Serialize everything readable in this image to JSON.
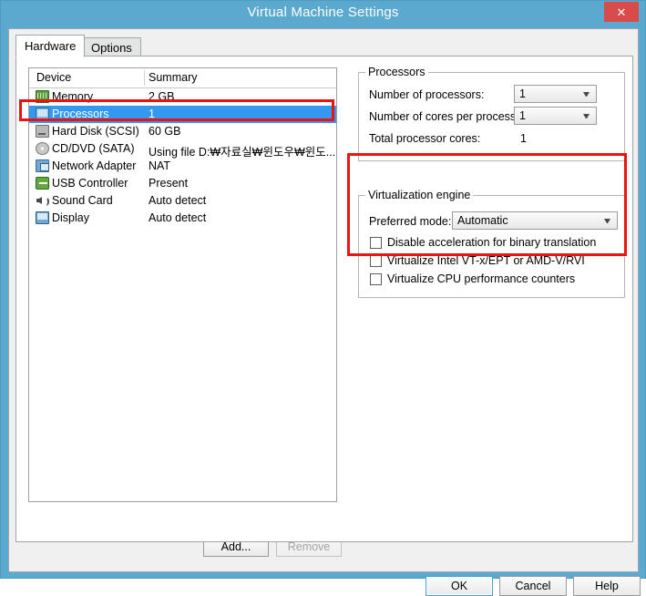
{
  "window": {
    "title": "Virtual Machine Settings",
    "close_label": "✕"
  },
  "tabs": [
    {
      "label": "Hardware",
      "active": true
    },
    {
      "label": "Options",
      "active": false
    }
  ],
  "device_list": {
    "columns": [
      "Device",
      "Summary"
    ],
    "rows": [
      {
        "device": "Memory",
        "summary": "2 GB",
        "icon": "memory-icon",
        "selected": false
      },
      {
        "device": "Processors",
        "summary": "1",
        "icon": "processor-icon",
        "selected": true
      },
      {
        "device": "Hard Disk (SCSI)",
        "summary": "60 GB",
        "icon": "harddisk-icon",
        "selected": false
      },
      {
        "device": "CD/DVD (SATA)",
        "summary": "Using file D:₩자료실₩윈도우₩윈도...",
        "icon": "cd-dvd-icon",
        "selected": false
      },
      {
        "device": "Network Adapter",
        "summary": "NAT",
        "icon": "network-icon",
        "selected": false
      },
      {
        "device": "USB Controller",
        "summary": "Present",
        "icon": "usb-icon",
        "selected": false
      },
      {
        "device": "Sound Card",
        "summary": "Auto detect",
        "icon": "sound-icon",
        "selected": false
      },
      {
        "device": "Display",
        "summary": "Auto detect",
        "icon": "display-icon",
        "selected": false
      }
    ]
  },
  "processors_group": {
    "legend": "Processors",
    "number_of_processors_label": "Number of processors:",
    "number_of_processors_value": "1",
    "cores_per_processor_label": "Number of cores per processor:",
    "cores_per_processor_value": "1",
    "total_cores_label": "Total processor cores:",
    "total_cores_value": "1"
  },
  "virtualization_group": {
    "legend": "Virtualization engine",
    "preferred_mode_label": "Preferred mode:",
    "preferred_mode_value": "Automatic",
    "checkboxes": [
      {
        "label": "Disable acceleration for binary translation",
        "checked": false
      },
      {
        "label": "Virtualize Intel VT-x/EPT or AMD-V/RVI",
        "checked": false
      },
      {
        "label": "Virtualize CPU performance counters",
        "checked": false
      }
    ]
  },
  "list_buttons": {
    "add": "Add...",
    "remove": "Remove"
  },
  "dialog_buttons": {
    "ok": "OK",
    "cancel": "Cancel",
    "help": "Help"
  },
  "colors": {
    "titlebar": "#5ba9ce",
    "close_button": "#d94a4a",
    "selection": "#3399f0",
    "annotation": "#ee1111"
  }
}
